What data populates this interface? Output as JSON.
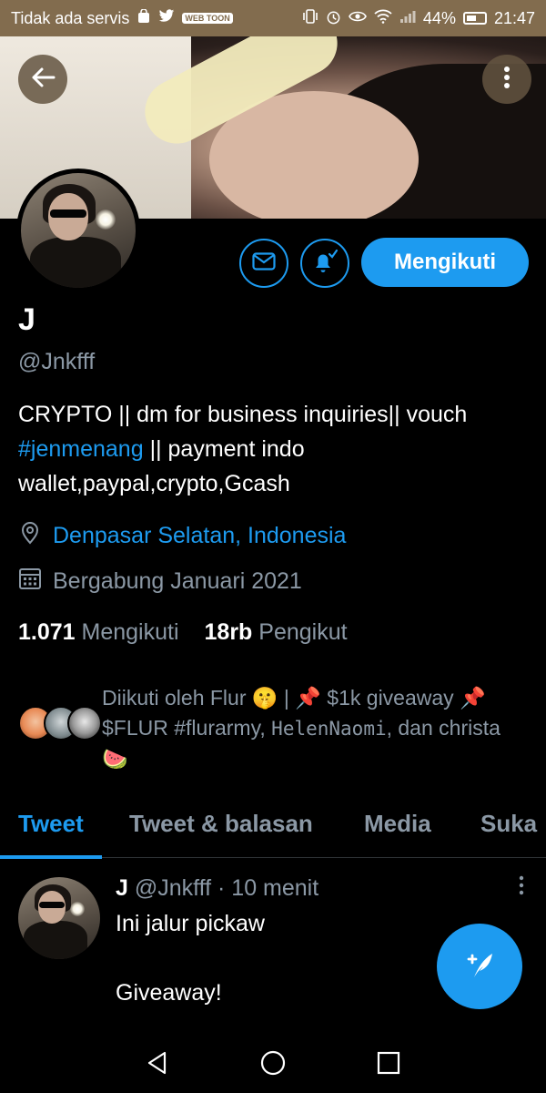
{
  "status_bar": {
    "carrier": "Tidak ada servis",
    "battery": "44%",
    "time": "21:47",
    "left_icons": [
      "shopping-bag-icon",
      "twitter-bird-icon",
      "webtoon-icon"
    ],
    "left_chip": "WEB TOON",
    "right_icons": [
      "vibrate-icon",
      "alarm-icon",
      "eye-icon",
      "wifi-icon",
      "signal-icon",
      "battery-icon"
    ]
  },
  "header": {
    "back_icon": "arrow-left-icon",
    "more_icon": "more-vertical-icon"
  },
  "profile": {
    "name": "J",
    "handle": "@Jnkfff",
    "bio_part1": "CRYPTO ||  dm for business inquiries|| vouch ",
    "bio_hashtag": "#jenmenang",
    "bio_part2": " || payment indo wallet,paypal,crypto,Gcash",
    "location": "Denpasar Selatan, Indonesia",
    "joined": "Bergabung Januari 2021",
    "following_count": "1.071",
    "following_label": "Mengikuti",
    "followers_count": "18rb",
    "followers_label": "Pengikut",
    "followed_by_prefix": "Diikuti oleh Flur 🤫 | 📌 $1k giveaway 📌 $FLUR #flurarmy, ",
    "followed_by_mono": "HelenNaomi",
    "followed_by_suffix": ", dan christa 🍉"
  },
  "actions": {
    "message_icon": "mail-icon",
    "notify_icon": "bell-check-icon",
    "follow_label": "Mengikuti"
  },
  "tabs": [
    {
      "label": "Tweet",
      "active": true
    },
    {
      "label": "Tweet & balasan",
      "active": false
    },
    {
      "label": "Media",
      "active": false
    },
    {
      "label": "Suka",
      "active": false
    }
  ],
  "tweet": {
    "author": "J",
    "handle": "@Jnkfff",
    "time": "10 menit",
    "text": "Ini jalur pickaw\n\nGiveaway!"
  },
  "fab_icon": "compose-tweet-icon",
  "nav": [
    "back-triangle-icon",
    "home-circle-icon",
    "recents-square-icon"
  ],
  "colors": {
    "accent": "#1d9bf0",
    "secondary_text": "#8b98a5",
    "status_bar": "#826c4e",
    "background": "#000000"
  }
}
